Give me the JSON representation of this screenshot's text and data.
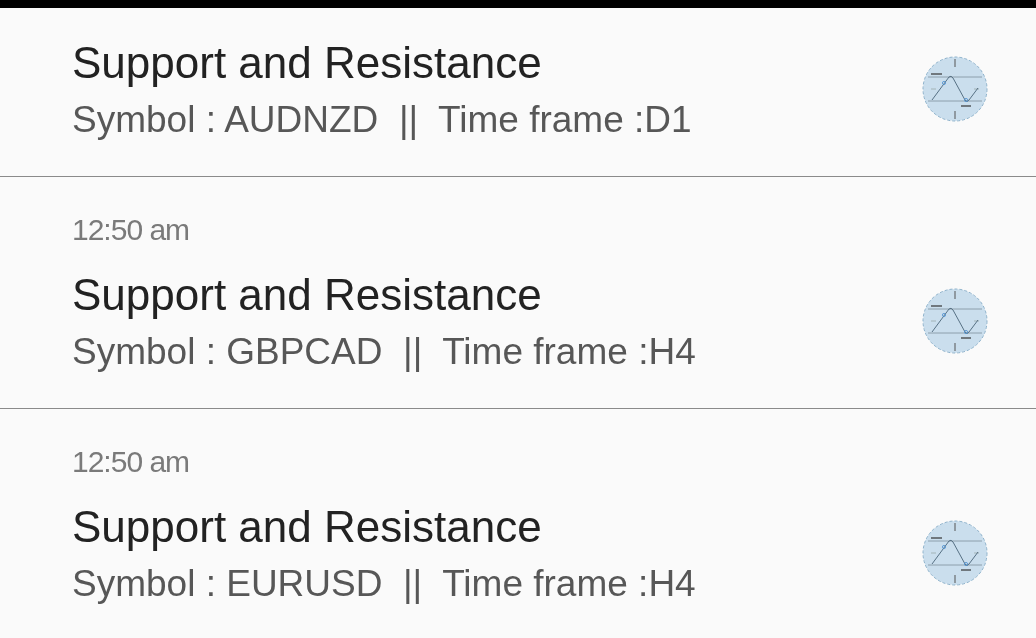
{
  "notifications": [
    {
      "title": "Support and Resistance",
      "text": "Symbol : AUDNZD  ||  Time frame :D1"
    },
    {
      "time": "12:50 am",
      "title": "Support and Resistance",
      "text": "Symbol : GBPCAD  ||  Time frame :H4"
    },
    {
      "time": "12:50 am",
      "title": "Support and Resistance",
      "text": "Symbol : EURUSD  ||  Time frame :H4"
    }
  ]
}
